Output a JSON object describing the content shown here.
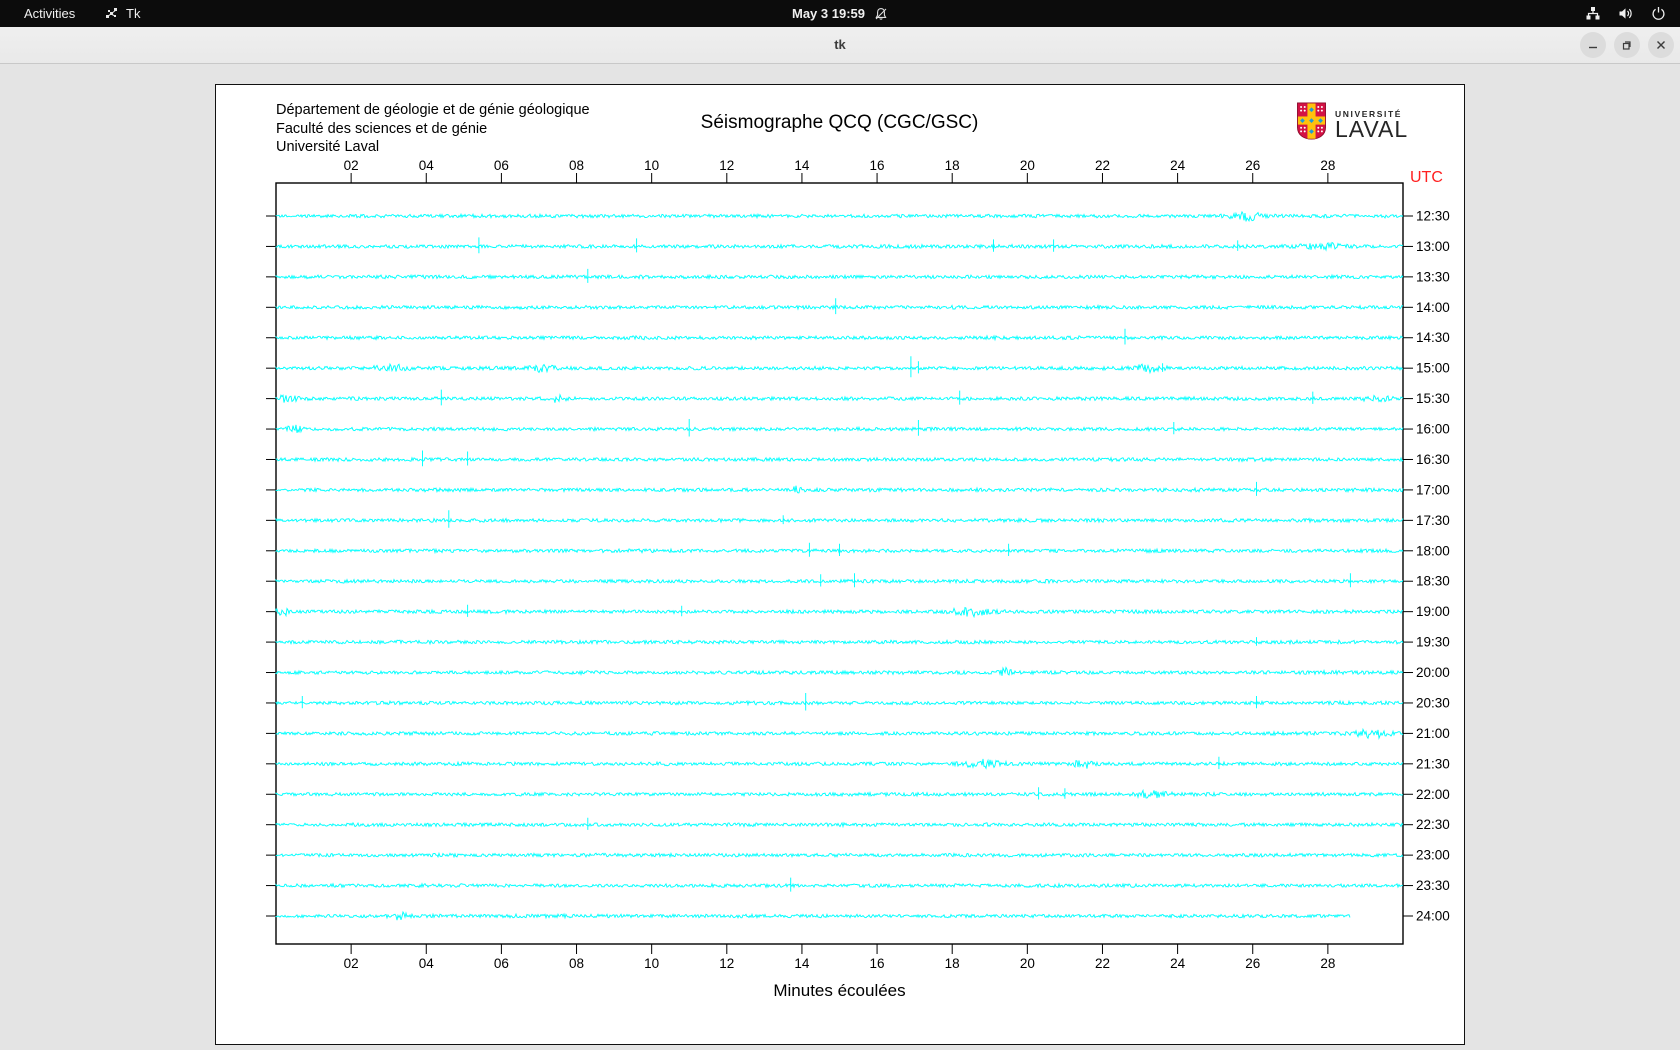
{
  "topbar": {
    "activities": "Activities",
    "app": "Tk",
    "clock": "May 3 19:59"
  },
  "titlebar": {
    "title": "tk"
  },
  "panel": {
    "institution_lines": [
      "Département de géologie et de génie géologique",
      "Faculté des sciences et de génie",
      "Université Laval"
    ],
    "logo_text_small": "UNIVERSITÉ",
    "logo_text_large": "LAVAL"
  },
  "chart_data": {
    "type": "line",
    "title": "Séismographe QCQ (CGC/GSC)",
    "xlabel": "Minutes écoulées",
    "utc_header": "UTC",
    "utc_color": "#ff2020",
    "trace_color": "#00ffff",
    "frame_color": "#000000",
    "minutes_per_row": 30,
    "x_tick_minutes": [
      2,
      4,
      6,
      8,
      10,
      12,
      14,
      16,
      18,
      20,
      22,
      24,
      26,
      28
    ],
    "x_ticks": [
      "02",
      "04",
      "06",
      "08",
      "10",
      "12",
      "14",
      "16",
      "18",
      "20",
      "22",
      "24",
      "26",
      "28"
    ],
    "rows": [
      {
        "utc": "12:30",
        "spikes": [],
        "bursts": [
          [
            25.8,
            4,
            10
          ]
        ]
      },
      {
        "utc": "13:00",
        "spikes": [
          [
            5.4,
            9
          ],
          [
            9.6,
            8
          ],
          [
            19.1,
            7
          ],
          [
            20.7,
            7
          ],
          [
            25.6,
            6
          ]
        ],
        "bursts": [
          [
            27.9,
            3,
            14
          ]
        ]
      },
      {
        "utc": "13:30",
        "spikes": [
          [
            8.3,
            8
          ]
        ],
        "bursts": []
      },
      {
        "utc": "14:00",
        "spikes": [
          [
            14.9,
            9
          ]
        ],
        "bursts": []
      },
      {
        "utc": "14:30",
        "spikes": [
          [
            22.6,
            9
          ]
        ],
        "bursts": []
      },
      {
        "utc": "15:00",
        "spikes": [
          [
            16.9,
            12
          ],
          [
            17.1,
            7
          ],
          [
            23.6,
            5
          ]
        ],
        "bursts": [
          [
            3.1,
            2.5,
            12
          ],
          [
            7.1,
            2.5,
            8
          ],
          [
            23.2,
            3,
            10
          ]
        ]
      },
      {
        "utc": "15:30",
        "spikes": [
          [
            4.4,
            9
          ],
          [
            18.2,
            8
          ],
          [
            27.6,
            7
          ]
        ],
        "bursts": [
          [
            0.3,
            3,
            8
          ],
          [
            7.5,
            3.5,
            4
          ],
          [
            29.3,
            3,
            8
          ]
        ]
      },
      {
        "utc": "16:00",
        "spikes": [
          [
            11.0,
            10
          ],
          [
            17.1,
            9
          ],
          [
            23.9,
            7
          ]
        ],
        "bursts": [
          [
            0.5,
            3,
            6
          ]
        ]
      },
      {
        "utc": "16:30",
        "spikes": [
          [
            3.9,
            9
          ],
          [
            5.1,
            8
          ]
        ],
        "bursts": []
      },
      {
        "utc": "17:00",
        "spikes": [
          [
            26.1,
            8
          ]
        ],
        "bursts": [
          [
            13.9,
            3.5,
            4
          ]
        ]
      },
      {
        "utc": "17:30",
        "spikes": [
          [
            4.6,
            10
          ],
          [
            13.5,
            5
          ]
        ],
        "bursts": []
      },
      {
        "utc": "18:00",
        "spikes": [
          [
            14.2,
            8
          ],
          [
            15.0,
            7
          ],
          [
            19.5,
            7
          ]
        ],
        "bursts": []
      },
      {
        "utc": "18:30",
        "spikes": [
          [
            14.5,
            7
          ],
          [
            15.4,
            8
          ],
          [
            28.6,
            8
          ]
        ],
        "bursts": []
      },
      {
        "utc": "19:00",
        "spikes": [
          [
            5.1,
            7
          ],
          [
            10.8,
            6
          ]
        ],
        "bursts": [
          [
            0.2,
            3,
            6
          ],
          [
            18.5,
            3.5,
            14
          ]
        ]
      },
      {
        "utc": "19:30",
        "spikes": [
          [
            26.1,
            5
          ]
        ],
        "bursts": []
      },
      {
        "utc": "20:00",
        "spikes": [],
        "bursts": [
          [
            19.4,
            3.5,
            5
          ]
        ]
      },
      {
        "utc": "20:30",
        "spikes": [
          [
            0.7,
            7
          ],
          [
            14.1,
            10
          ],
          [
            26.1,
            7
          ]
        ],
        "bursts": []
      },
      {
        "utc": "21:00",
        "spikes": [],
        "bursts": [
          [
            29.2,
            3.5,
            12
          ]
        ]
      },
      {
        "utc": "21:30",
        "spikes": [
          [
            25.1,
            7
          ]
        ],
        "bursts": [
          [
            18.8,
            3.5,
            12
          ],
          [
            21.5,
            3.5,
            6
          ]
        ]
      },
      {
        "utc": "22:00",
        "spikes": [
          [
            20.3,
            7
          ],
          [
            21.0,
            6
          ]
        ],
        "bursts": [
          [
            23.3,
            3,
            10
          ]
        ]
      },
      {
        "utc": "22:30",
        "spikes": [
          [
            8.3,
            7
          ]
        ],
        "bursts": []
      },
      {
        "utc": "23:00",
        "spikes": [],
        "bursts": []
      },
      {
        "utc": "23:30",
        "spikes": [
          [
            13.7,
            8
          ]
        ],
        "bursts": []
      },
      {
        "utc": "24:00",
        "end": 28.6,
        "spikes": [],
        "bursts": [
          [
            3.3,
            3,
            6
          ]
        ]
      }
    ]
  }
}
